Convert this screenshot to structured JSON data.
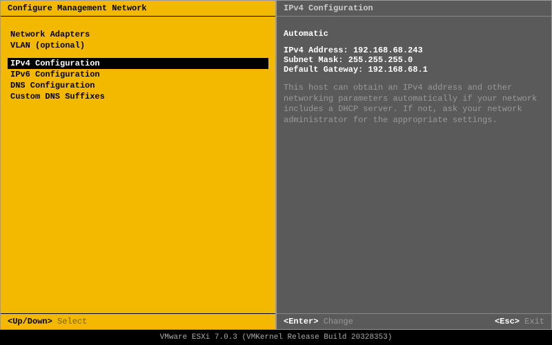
{
  "left": {
    "title": "Configure Management Network",
    "menu": {
      "group1": [
        "Network Adapters",
        "VLAN (optional)"
      ],
      "group2": [
        "IPv4 Configuration",
        "IPv6 Configuration",
        "DNS Configuration",
        "Custom DNS Suffixes"
      ],
      "selected_index": 0
    },
    "footer": {
      "key": "<Up/Down>",
      "label": "Select"
    }
  },
  "right": {
    "title": "IPv4 Configuration",
    "mode": "Automatic",
    "ipv4_label": "IPv4 Address:",
    "ipv4_value": "192.168.68.243",
    "mask_label": "Subnet Mask:",
    "mask_value": "255.255.255.0",
    "gateway_label": "Default Gateway:",
    "gateway_value": "192.168.68.1",
    "description": "This host can obtain an IPv4 address and other networking parameters automatically if your network includes a DHCP server. If not, ask your network administrator for the appropriate settings.",
    "footer_left": {
      "key": "<Enter>",
      "label": "Change"
    },
    "footer_right": {
      "key": "<Esc>",
      "label": "Exit"
    }
  },
  "bottom": "VMware ESXi 7.0.3 (VMKernel Release Build 20328353)"
}
